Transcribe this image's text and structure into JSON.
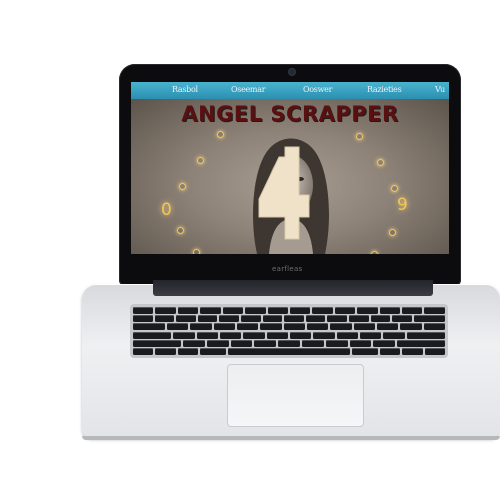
{
  "site": {
    "nav_items": [
      "Rasbol",
      "Oseemar",
      "Ooswer",
      "Razieties",
      "Vu"
    ],
    "title": "ANGEL SCRAPPER",
    "dial_numerals": [
      "0",
      "9"
    ]
  },
  "laptop": {
    "brand_label": "earfleas"
  },
  "colors": {
    "nav_bar": "#3aa3c2",
    "title": "#5a1010",
    "numerals": "#f3c655"
  }
}
